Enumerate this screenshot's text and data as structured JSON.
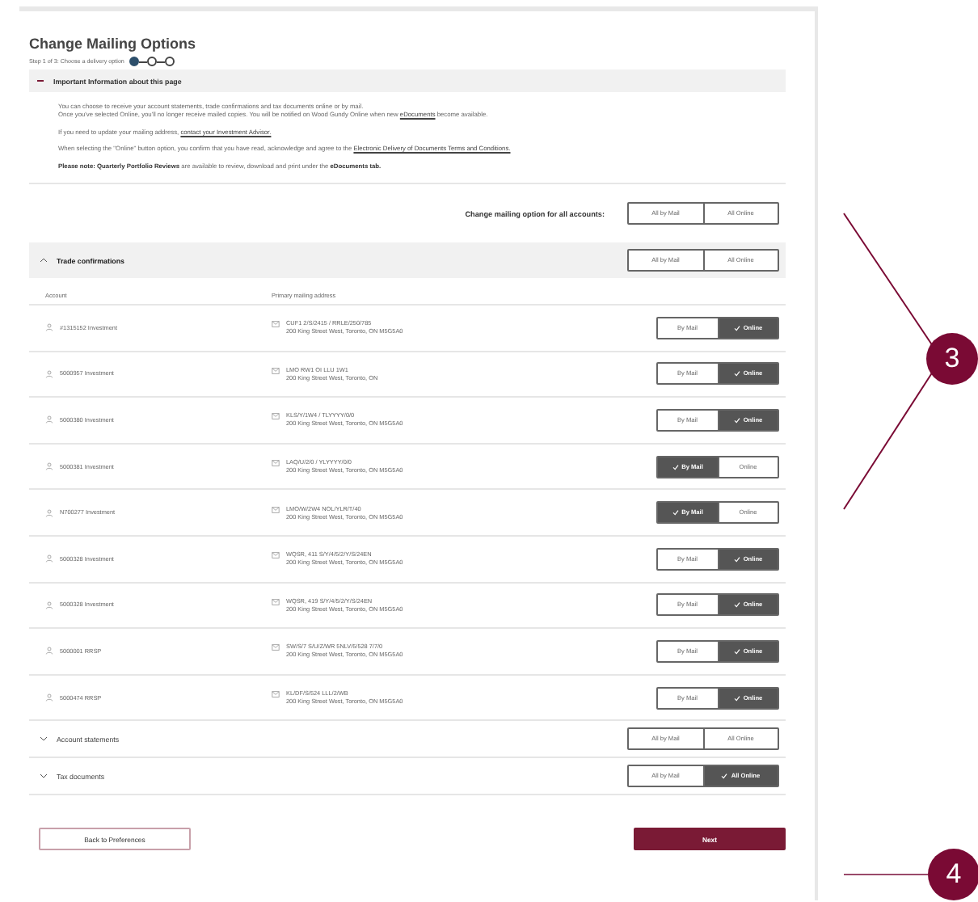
{
  "page": {
    "title": "Change Mailing Options",
    "step_text": "Step 1 of 3: Choose a delivery option",
    "steps": [
      {
        "selected": true
      },
      {
        "selected": false
      },
      {
        "selected": false
      }
    ]
  },
  "info": {
    "title": "Important Information about this page",
    "expanded": true,
    "paragraphs": [
      [
        [
          {
            "kind": "text",
            "text": "You can choose to receive your account statements, trade confirmations and tax documents online or by mail."
          }
        ],
        [
          {
            "kind": "text",
            "text": "Once you've selected Online, you'll no longer receive mailed copies. You will be notified on Wood Gundy Online when new "
          },
          {
            "kind": "link",
            "text": "eDocuments"
          },
          {
            "kind": "text",
            "text": " become available."
          }
        ]
      ],
      [
        [
          {
            "kind": "text",
            "text": "If you need to update your mailing address, "
          },
          {
            "kind": "link",
            "text": "contact your Investment Advisor."
          }
        ]
      ],
      [
        [
          {
            "kind": "text",
            "text": "When selecting the \"Online\" button option, you confirm that you have read, acknowledge and agree to the "
          },
          {
            "kind": "link",
            "text": "Electronic Delivery of Documents Terms and Conditions."
          }
        ]
      ],
      [
        [
          {
            "kind": "text",
            "text": "**Please note: Quarterly Portfolio Reviews** are available to review, download and print under the **eDocuments tab.**"
          }
        ]
      ]
    ]
  },
  "change_all": {
    "label": "Change mailing option for all accounts:",
    "options": [
      {
        "label": "All by Mail",
        "selected": false
      },
      {
        "label": "All Online",
        "selected": false
      }
    ]
  },
  "sections": [
    {
      "title": "Trade confirmations",
      "expanded": true,
      "options": [
        {
          "label": "All by Mail",
          "selected": false
        },
        {
          "label": "All Online",
          "selected": false
        }
      ],
      "columns": [
        "Account",
        "Primary mailing address"
      ],
      "accounts": [
        {
          "account": "#1315152 Investment",
          "name": "CUF1 2/S/2415 / RRLE/250/785",
          "address": "200 King Street West, Toronto, ON M5G5A0",
          "options": [
            {
              "label": "By Mail",
              "selected": false
            },
            {
              "label": "Online",
              "selected": true
            }
          ]
        },
        {
          "account": "5000957 Investment",
          "name": "LMO RW1 OI LLU 1W1",
          "address": "200 King Street West, Toronto, ON",
          "options": [
            {
              "label": "By Mail",
              "selected": false
            },
            {
              "label": "Online",
              "selected": true
            }
          ]
        },
        {
          "account": "5000380 Investment",
          "name": "KLS/Y/1W4 / TLYYYY/0/0",
          "address": "200 King Street West, Toronto, ON M5G5A0",
          "options": [
            {
              "label": "By Mail",
              "selected": false
            },
            {
              "label": "Online",
              "selected": true
            }
          ]
        },
        {
          "account": "5000381 Investment",
          "name": "LAQ/U/2/0 / YLYYYY/0/0",
          "address": "200 King Street West, Toronto, ON M5G5A0",
          "options": [
            {
              "label": "By Mail",
              "selected": true
            },
            {
              "label": "Online",
              "selected": false
            }
          ]
        },
        {
          "account": "N700277 Investment",
          "name": "LMO/W/2W4 NOL/YLR/T/40",
          "address": "200 King Street West, Toronto, ON M5G5A0",
          "options": [
            {
              "label": "By Mail",
              "selected": true
            },
            {
              "label": "Online",
              "selected": false
            }
          ]
        },
        {
          "account": "5000328 Investment",
          "name": "WQSR, 411 S/Y/4/5/2/Y/S/24EN",
          "address": "200 King Street West, Toronto, ON M5G5A0",
          "options": [
            {
              "label": "By Mail",
              "selected": false
            },
            {
              "label": "Online",
              "selected": true
            }
          ]
        },
        {
          "account": "5000328 Investment",
          "name": "WQSR, 419 S/Y/4/5/2/Y/S/24EN",
          "address": "200 King Street West, Toronto, ON M5G5A0",
          "options": [
            {
              "label": "By Mail",
              "selected": false
            },
            {
              "label": "Online",
              "selected": true
            }
          ]
        },
        {
          "account": "5000001 RRSP",
          "name": "SW/S/7 S/U/Z/WR 5NLV/5/528 7/7/0",
          "address": "200 King Street West, Toronto, ON M5G5A0",
          "options": [
            {
              "label": "By Mail",
              "selected": false
            },
            {
              "label": "Online",
              "selected": true
            }
          ]
        },
        {
          "account": "5000474 RRSP",
          "name": "KL/DF/S/524 LLL/2/WB",
          "address": "200 King Street West, Toronto, ON M5G5A0",
          "options": [
            {
              "label": "By Mail",
              "selected": false
            },
            {
              "label": "Online",
              "selected": true
            }
          ]
        }
      ]
    },
    {
      "title": "Account statements",
      "expanded": false,
      "options": [
        {
          "label": "All by Mail",
          "selected": false
        },
        {
          "label": "All Online",
          "selected": false
        }
      ]
    },
    {
      "title": "Tax documents",
      "expanded": false,
      "options": [
        {
          "label": "All by Mail",
          "selected": false
        },
        {
          "label": "All Online",
          "selected": true
        }
      ]
    }
  ],
  "buttons": [
    {
      "label": "Back to Preferences",
      "kind": "secondary"
    },
    {
      "label": "Next",
      "kind": "primary"
    }
  ],
  "callouts": [
    {
      "label": "3"
    },
    {
      "label": "4"
    }
  ]
}
